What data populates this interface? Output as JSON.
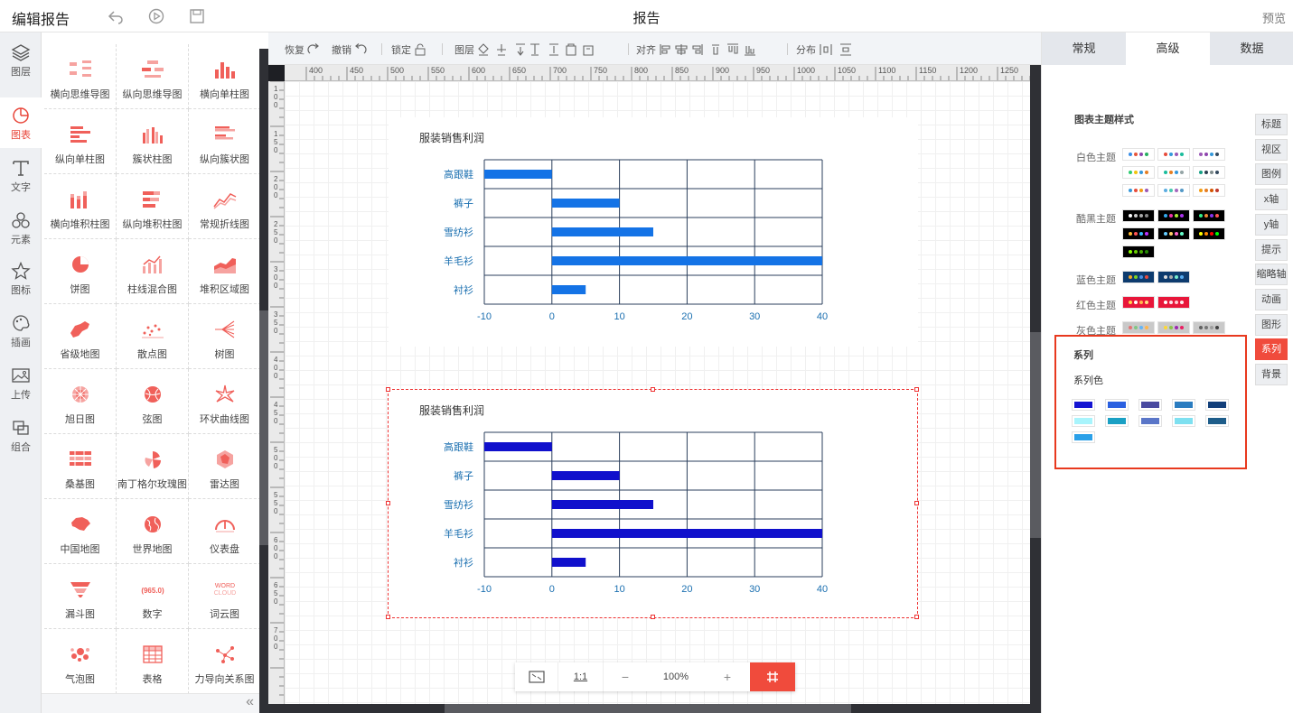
{
  "header": {
    "title": "编辑报告",
    "center": "报告",
    "preview": "预览"
  },
  "leftnav": [
    {
      "label": "图层",
      "icon": "layers-icon"
    },
    {
      "label": "图表",
      "icon": "chart-icon",
      "active": true
    },
    {
      "label": "文字",
      "icon": "text-icon"
    },
    {
      "label": "元素",
      "icon": "elements-icon"
    },
    {
      "label": "图标",
      "icon": "star-icon"
    },
    {
      "label": "插画",
      "icon": "palette-icon"
    },
    {
      "label": "上传",
      "icon": "upload-icon"
    },
    {
      "label": "组合",
      "icon": "group-icon"
    }
  ],
  "palette": [
    "横向思维导图",
    "纵向思维导图",
    "横向单柱图",
    "纵向单柱图",
    "簇状柱图",
    "纵向簇状图",
    "横向堆积柱图",
    "纵向堆积柱图",
    "常规折线图",
    "饼图",
    "柱线混合图",
    "堆积区域图",
    "省级地图",
    "散点图",
    "树图",
    "旭日图",
    "弦图",
    "环状曲线图",
    "桑基图",
    "南丁格尔玫瑰图",
    "雷达图",
    "中国地图",
    "世界地图",
    "仪表盘",
    "漏斗图",
    "数字",
    "词云图",
    "气泡图",
    "表格",
    "力导向关系图"
  ],
  "palette_icons": {
    "number_text": "965.0",
    "wordcloud_top": "WORD",
    "wordcloud_bottom": "CLOUD"
  },
  "toolbar": {
    "redo": "恢复",
    "undo": "撤销",
    "lock": "锁定",
    "layer": "图层",
    "align": "对齐",
    "distribute": "分布"
  },
  "ruler_h": [
    "400",
    "450",
    "500",
    "550",
    "600",
    "650",
    "700",
    "750",
    "800",
    "850",
    "900",
    "950",
    "1000",
    "1050",
    "1100",
    "1150",
    "1200",
    "1250"
  ],
  "ruler_v": [
    "100",
    "150",
    "200",
    "250",
    "300",
    "350",
    "400",
    "450",
    "500",
    "550",
    "600",
    "650",
    "700"
  ],
  "charts": [
    {
      "title": "服装销售利润",
      "bar_color": "#1473e6"
    },
    {
      "title": "服装销售利润",
      "bar_color": "#1010cc"
    }
  ],
  "chart_data": [
    {
      "type": "bar",
      "orientation": "horizontal",
      "title": "服装销售利润",
      "categories": [
        "高跟鞋",
        "裤子",
        "雪纺衫",
        "羊毛衫",
        "衬衫"
      ],
      "values": [
        -10,
        10,
        15,
        40,
        5
      ],
      "xlim": [
        -10,
        40
      ],
      "xticks": [
        "-10",
        "0",
        "10",
        "20",
        "30",
        "40"
      ],
      "grid": true
    },
    {
      "type": "bar",
      "orientation": "horizontal",
      "title": "服装销售利润",
      "categories": [
        "高跟鞋",
        "裤子",
        "雪纺衫",
        "羊毛衫",
        "衬衫"
      ],
      "values": [
        -10,
        10,
        15,
        40,
        5
      ],
      "xlim": [
        -10,
        40
      ],
      "xticks": [
        "-10",
        "0",
        "10",
        "20",
        "30",
        "40"
      ],
      "grid": true
    }
  ],
  "zoom": {
    "ratio": "1:1",
    "minus": "−",
    "value": "100%",
    "plus": "+"
  },
  "rpanel": {
    "tabs": [
      "常规",
      "高级",
      "数据"
    ],
    "active_tab": "高级",
    "theme_title": "图表主题样式",
    "themes": [
      {
        "label": "白色主题",
        "rows": 3,
        "bg": "#ffffff"
      },
      {
        "label": "酷黑主题",
        "rows": 3,
        "bg": "#000000"
      },
      {
        "label": "蓝色主题",
        "rows": 1,
        "bg": "#0d3b6e"
      },
      {
        "label": "红色主题",
        "rows": 1,
        "bg": "#e8163a"
      },
      {
        "label": "灰色主题",
        "rows": 1,
        "bg": "#c9c9c9"
      }
    ],
    "series_title": "系列",
    "series_color_title": "系列色",
    "series_colors": [
      "#1414d2",
      "#2a60e0",
      "#4a4aa0",
      "#2a7cc0",
      "#123f7a",
      "#a8f4fc",
      "#1aa0c4",
      "#5a76c8",
      "#7ee0f0",
      "#1e5d8a",
      "#2aa0e8"
    ],
    "side_buttons": [
      "标题",
      "视区",
      "图例",
      "x轴",
      "y轴",
      "提示",
      "缩略轴",
      "动画",
      "图形",
      "系列",
      "背景"
    ],
    "side_active": "系列"
  }
}
